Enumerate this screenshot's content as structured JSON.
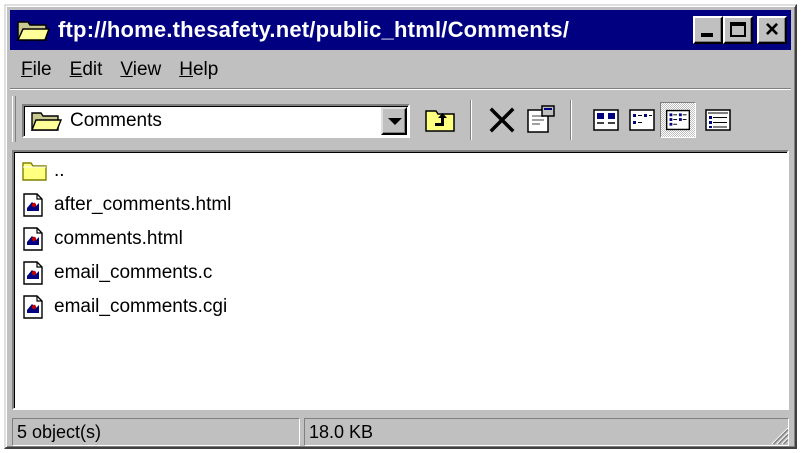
{
  "window": {
    "title": "ftp://home.thesafety.net/public_html/Comments/"
  },
  "menu": [
    {
      "pre": "",
      "key": "F",
      "rest": "ile"
    },
    {
      "pre": "",
      "key": "E",
      "rest": "dit"
    },
    {
      "pre": "",
      "key": "V",
      "rest": "iew"
    },
    {
      "pre": "",
      "key": "H",
      "rest": "elp"
    }
  ],
  "address": {
    "value": "Comments"
  },
  "files": [
    {
      "name": "..",
      "type": "folder-up"
    },
    {
      "name": "after_comments.html",
      "type": "file"
    },
    {
      "name": "comments.html",
      "type": "file"
    },
    {
      "name": "email_comments.c",
      "type": "file"
    },
    {
      "name": "email_comments.cgi",
      "type": "file"
    }
  ],
  "status": {
    "objects": "5 object(s)",
    "size": "18.0 KB"
  },
  "colors": {
    "titlebar": "#000080",
    "face": "#c0c0c0",
    "folder": "#ffff80"
  }
}
